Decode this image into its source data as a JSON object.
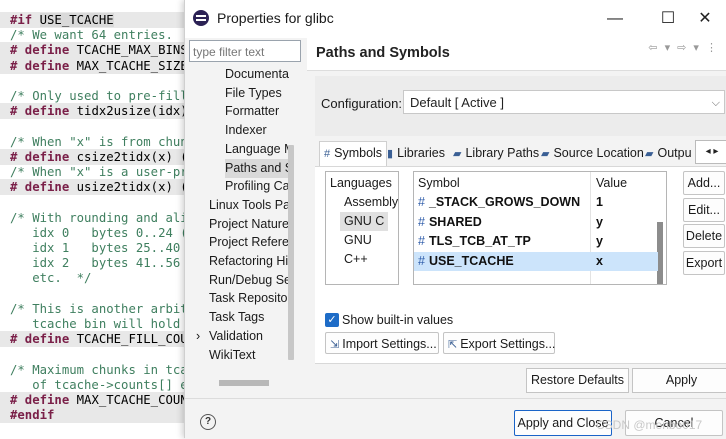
{
  "editor": {
    "lines": [
      {
        "pre": "#if ",
        "sel": "USE_TCACHE",
        "kind": "pp"
      },
      {
        "text": "/* We want 64 entries.",
        "kind": "cm"
      },
      {
        "pre": "# define ",
        "rest": "TCACHE_MAX_BINS",
        "kind": "pp"
      },
      {
        "pre": "# define ",
        "rest": "MAX_TCACHE_SIZE",
        "kind": "pp"
      },
      {
        "text": "",
        "kind": "blank"
      },
      {
        "text": "/* Only used to pre-fill",
        "kind": "cm"
      },
      {
        "pre": "# define ",
        "rest": "tidx2usize(idx)",
        "kind": "pp"
      },
      {
        "text": "",
        "kind": "blank"
      },
      {
        "text": "/* When \"x\" is from chun",
        "kind": "cm"
      },
      {
        "pre": "# define ",
        "rest": "csize2tidx(x) (",
        "kind": "pp"
      },
      {
        "text": "/* When \"x\" is a user-pr",
        "kind": "cm"
      },
      {
        "pre": "# define ",
        "rest": "usize2tidx(x) (",
        "kind": "pp"
      },
      {
        "text": "",
        "kind": "blank"
      },
      {
        "text": "/* With rounding and ali",
        "kind": "cm"
      },
      {
        "text": "   idx 0   bytes 0..24 (",
        "kind": "cm"
      },
      {
        "text": "   idx 1   bytes 25..40",
        "kind": "cm"
      },
      {
        "text": "   idx 2   bytes 41..56",
        "kind": "cm"
      },
      {
        "text": "   etc.  */",
        "kind": "cm"
      },
      {
        "text": "",
        "kind": "blank"
      },
      {
        "text": "/* This is another arbit",
        "kind": "cm"
      },
      {
        "text": "   tcache bin will hold",
        "kind": "cm"
      },
      {
        "pre": "# define ",
        "rest": "TCACHE_FILL_COU",
        "kind": "pp"
      },
      {
        "text": "",
        "kind": "blank"
      },
      {
        "text": "/* Maximum chunks in tca",
        "kind": "cm"
      },
      {
        "text": "   of tcache->counts[] e",
        "kind": "cm"
      },
      {
        "pre": "# define ",
        "rest": "MAX_TCACHE_COUN",
        "kind": "pp"
      },
      {
        "pre": "#endif",
        "rest": "",
        "kind": "pp"
      }
    ]
  },
  "dialog": {
    "title": "Properties for glibc",
    "minimize": "—",
    "maximize": "☐",
    "close": "✕",
    "filter_placeholder": "type filter text",
    "tree": [
      {
        "label": "Documenta",
        "indent": 1
      },
      {
        "label": "File Types",
        "indent": 1
      },
      {
        "label": "Formatter",
        "indent": 1
      },
      {
        "label": "Indexer",
        "indent": 1
      },
      {
        "label": "Language M",
        "indent": 1
      },
      {
        "label": "Paths and S",
        "indent": 1,
        "selected": true
      },
      {
        "label": "Profiling Ca",
        "indent": 1
      },
      {
        "label": "Linux Tools Pa",
        "indent": 0
      },
      {
        "label": "Project Nature",
        "indent": 0
      },
      {
        "label": "Project Referer",
        "indent": 0
      },
      {
        "label": "Refactoring Hi",
        "indent": 0
      },
      {
        "label": "Run/Debug Se",
        "indent": 0
      },
      {
        "label": "Task Repositor",
        "indent": 0
      },
      {
        "label": "Task Tags",
        "indent": 0
      },
      {
        "label": "Validation",
        "indent": 0,
        "expander": "›"
      },
      {
        "label": "WikiText",
        "indent": 0
      }
    ],
    "page_title": "Paths and Symbols",
    "nav_arrows": "⇦ ▾ ⇨ ▾ ⋮",
    "configuration_label": "Configuration:",
    "configuration_value": "Default  [ Active ]",
    "tabs": [
      {
        "label": "Symbols",
        "icon": "#",
        "active": true
      },
      {
        "label": "Libraries",
        "icon": "▮"
      },
      {
        "label": "Library Paths",
        "icon": "▰"
      },
      {
        "label": "Source Location",
        "icon": "▰"
      },
      {
        "label": "Outpu",
        "icon": "▰"
      }
    ],
    "tab_scroll": "◂ ▸",
    "languages_header": "Languages",
    "languages": [
      "Assembly",
      "GNU C",
      "GNU C++"
    ],
    "selected_language": "GNU C",
    "symbols_header": "Symbol",
    "value_header": "Value",
    "symbols": [
      {
        "name": "_STACK_GROWS_DOWN",
        "value": "1"
      },
      {
        "name": "SHARED",
        "value": "y"
      },
      {
        "name": "TLS_TCB_AT_TP",
        "value": "y"
      },
      {
        "name": "USE_TCACHE",
        "value": "x",
        "selected": true
      }
    ],
    "side_buttons": [
      "Add...",
      "Edit...",
      "Delete",
      "Export"
    ],
    "show_builtin_label": "Show built-in values",
    "show_builtin_checked": true,
    "import_settings": "Import Settings...",
    "export_settings": "Export Settings...",
    "restore_defaults": "Restore Defaults",
    "apply": "Apply",
    "apply_and_close": "Apply and Close",
    "cancel": "Cancel",
    "help": "?"
  },
  "watermark": "CSDN @menbo017"
}
